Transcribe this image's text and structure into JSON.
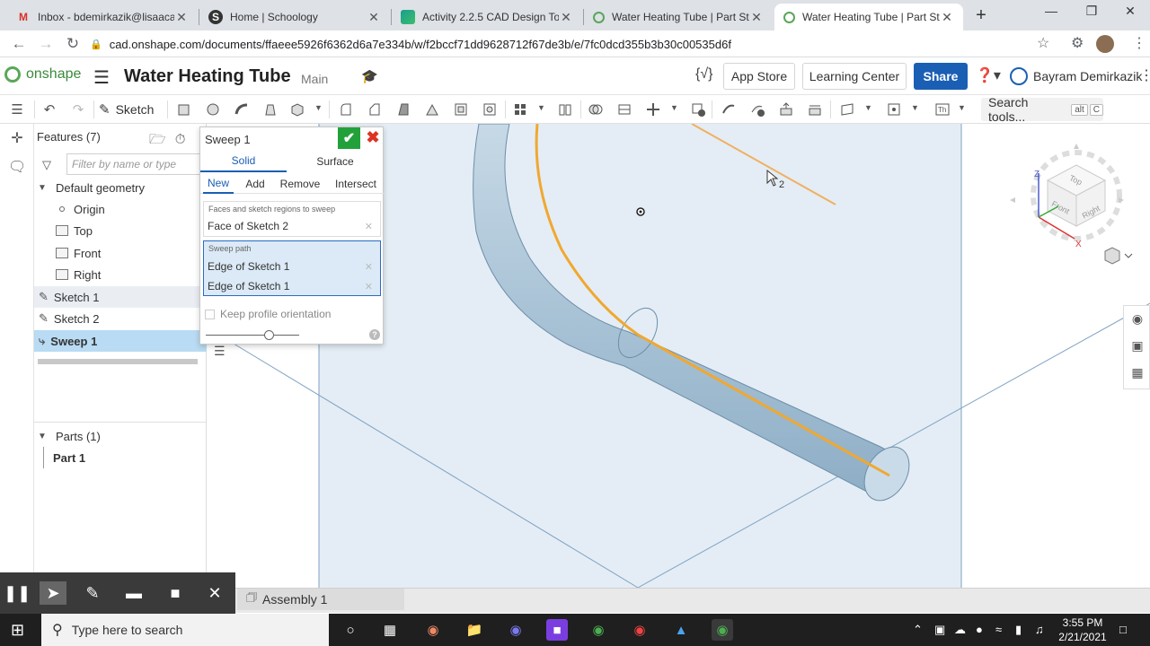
{
  "browser": {
    "tabs": [
      {
        "label": "Inbox - bdemirkazik@lisaacad",
        "icon": "gmail-icon",
        "active": false
      },
      {
        "label": "Home | Schoology",
        "icon": "schoology-icon",
        "active": false
      },
      {
        "label": "Activity 2.2.5 CAD Design Tool",
        "icon": "slides-icon",
        "active": false
      },
      {
        "label": "Water Heating Tube | Part Stud",
        "icon": "onshape-icon",
        "active": false
      },
      {
        "label": "Water Heating Tube | Part Stud",
        "icon": "onshape-icon",
        "active": true
      }
    ],
    "url": "cad.onshape.com/documents/ffaeee5926f6362d6a7e334b/w/f2bccf71dd9628712f67de3b/e/7fc0dcd355b3b30c00535d6f"
  },
  "header": {
    "brand": "onshape",
    "doc_title": "Water Heating Tube",
    "branch": "Main",
    "app_store": "App Store",
    "learning_center": "Learning Center",
    "share": "Share",
    "user": "Bayram Demirkazik"
  },
  "toolbar": {
    "sketch": "Sketch",
    "search_tools": "Search tools...",
    "kbd_alt": "alt",
    "kbd_c": "C"
  },
  "features": {
    "title": "Features (7)",
    "filter_placeholder": "Filter by name or type",
    "default_geometry": "Default geometry",
    "items": {
      "origin": "Origin",
      "top": "Top",
      "front": "Front",
      "right": "Right",
      "sketch1": "Sketch 1",
      "sketch2": "Sketch 2",
      "sweep1": "Sweep 1"
    },
    "parts_header": "Parts (1)",
    "part1": "Part 1"
  },
  "sweep_dialog": {
    "title": "Sweep 1",
    "tab_solid": "Solid",
    "tab_surface": "Surface",
    "op_new": "New",
    "op_add": "Add",
    "op_remove": "Remove",
    "op_intersect": "Intersect",
    "faces_label": "Faces and sketch regions to sweep",
    "faces_item": "Face of Sketch 2",
    "path_label": "Sweep path",
    "path_items": [
      "Edge of Sketch 1",
      "Edge of Sketch 1"
    ],
    "keep_profile": "Keep profile orientation"
  },
  "viewport": {
    "cursor_label": "2",
    "cube_top": "Top",
    "cube_front": "Front",
    "cube_right": "Right",
    "axis_x": "X",
    "axis_z": "Z"
  },
  "bottom": {
    "assembly_tab": "Assembly 1"
  },
  "taskbar": {
    "search": "Type here to search",
    "time": "3:55 PM",
    "date": "2/21/2021"
  },
  "colors": {
    "accent": "#1b5fb4",
    "confirm": "#22a13a",
    "path": "#f0a830",
    "tube": "#a9c3d6"
  }
}
